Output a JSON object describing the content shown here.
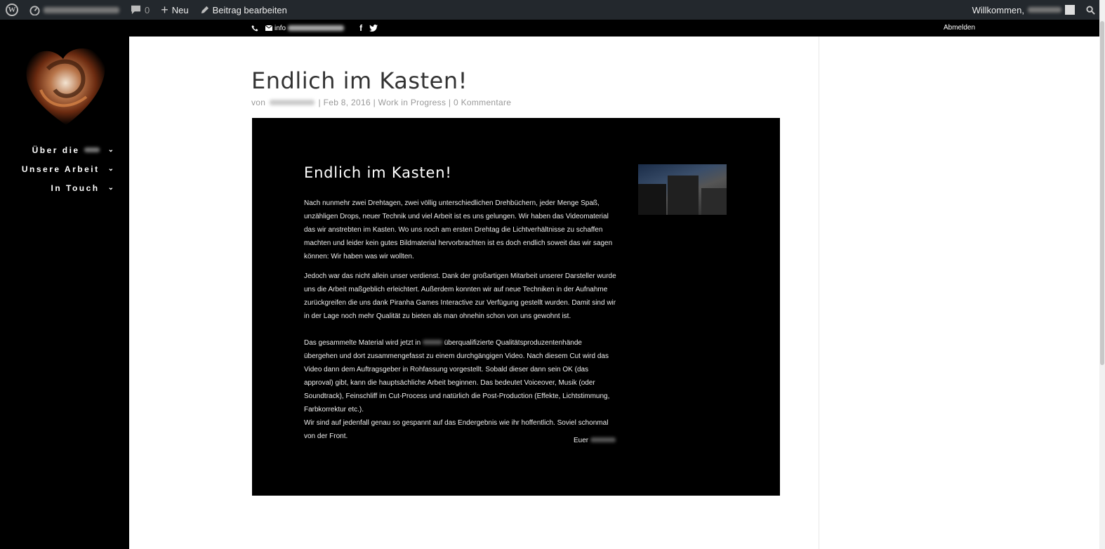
{
  "adminbar": {
    "comments_count": "0",
    "new_label": "Neu",
    "edit_label": "Beitrag bearbeiten",
    "welcome_label": "Willkommen,"
  },
  "topbar": {
    "email_prefix": "info",
    "logout_label": "Abmelden"
  },
  "nav": {
    "items": [
      {
        "label": "Über die"
      },
      {
        "label": "Unsere Arbeit"
      },
      {
        "label": "In Touch"
      }
    ]
  },
  "post": {
    "title": "Endlich im Kasten!",
    "meta_by": "von",
    "date": "Feb 8, 2016",
    "category": "Work in Progress",
    "comments": "0 Kommentare",
    "content_heading": "Endlich im Kasten!",
    "paragraph1": "Nach nunmehr zwei Drehtagen, zwei völlig unterschiedlichen Drehbüchern, jeder Menge Spaß, unzähligen Drops, neuer Technik und viel Arbeit ist es uns gelungen. Wir haben das Videomaterial das wir anstrebten im Kasten. Wo uns noch am ersten Drehtag die Lichtverhältnisse zu schaffen machten und leider kein gutes Bildmaterial hervorbrachten ist es doch endlich soweit das wir sagen können: Wir haben was wir wollten.",
    "paragraph2": "Jedoch war das nicht allein unser verdienst. Dank der großartigen Mitarbeit unserer Darsteller wurde uns die Arbeit maßgeblich erleichtert. Außerdem konnten wir auf neue Techniken in der Aufnahme zurückgreifen die uns dank Piranha Games Interactive zur Verfügung gestellt wurden. Damit sind wir in der Lage noch mehr Qualität zu bieten als man ohnehin schon von uns gewohnt ist.",
    "paragraph3_before": "Das gesammelte Material wird jetzt in",
    "paragraph3_after": "überqualifizierte Qualitätsproduzentenhände übergehen und dort zusammengefasst zu einem durchgängigen Video. Nach diesem Cut wird das Video dann dem Auftragsgeber in Rohfassung vorgestellt. Sobald dieser dann sein OK (das approval) gibt, kann die hauptsächliche Arbeit beginnen. Das bedeutet Voiceover, Musik (oder Soundtrack), Feinschliff im Cut-Process und natürlich die Post-Production (Effekte, Lichtstimmung, Farbkorrektur etc.).",
    "paragraph3_end": "Wir sind auf jedenfall genau so gespannt auf das Endergebnis wie ihr hoffentlich. Soviel schonmal von der Front.",
    "signature": "Euer"
  }
}
